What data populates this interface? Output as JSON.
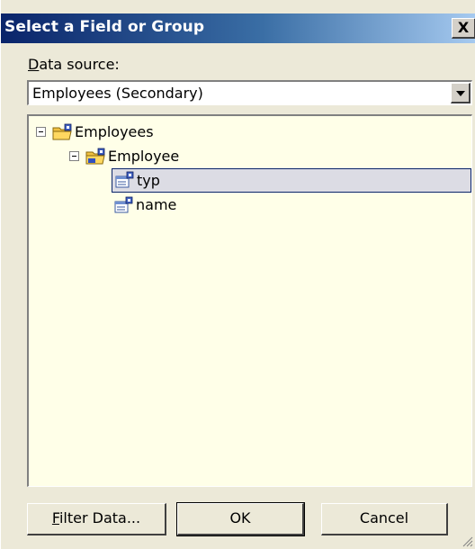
{
  "dialog": {
    "title": "Select a Field or Group",
    "close_label": "X"
  },
  "data_source": {
    "label_accel": "D",
    "label_rest": "ata source:",
    "selected": "Employees (Secondary)"
  },
  "tree": {
    "nodes": [
      {
        "label": "Employees",
        "type": "group",
        "expanded": true,
        "selected": false
      },
      {
        "label": "Employee",
        "type": "repeating-group",
        "expanded": true,
        "selected": false
      },
      {
        "label": "typ",
        "type": "field",
        "selected": true
      },
      {
        "label": "name",
        "type": "field",
        "selected": false
      }
    ]
  },
  "buttons": {
    "filter_accel": "F",
    "filter_rest": "ilter Data...",
    "ok": "OK",
    "cancel": "Cancel"
  },
  "icons": {
    "close": "close-icon",
    "dropdown": "chevron-down-icon",
    "group": "folder-icon",
    "repeating_group": "repeating-folder-icon",
    "field": "field-icon",
    "expander": "collapse-icon",
    "grip": "resize-grip-icon"
  },
  "colors": {
    "title_start": "#0a246a",
    "title_end": "#a6caf0",
    "tree_bg": "#ffffe8",
    "dialog_bg": "#ece9d8",
    "selection_border": "#0a246a"
  }
}
